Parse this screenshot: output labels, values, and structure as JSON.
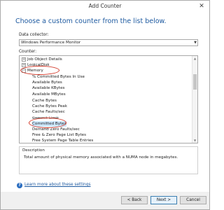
{
  "window": {
    "title": "Add Counter",
    "close_label": "✕"
  },
  "heading": "Choose a custom counter from the list below.",
  "data_collector": {
    "label": "Data collector:",
    "value": "Windows Performance Monitor",
    "arrow": "▼"
  },
  "counter": {
    "label": "Counter:",
    "rows": [
      {
        "text": "Job Object Details",
        "expander": "+"
      },
      {
        "text": "LogicalDisk",
        "expander": "+"
      },
      {
        "text": "Memory",
        "expander": "−"
      },
      {
        "text": "% Committed Bytes In Use"
      },
      {
        "text": "Available Bytes"
      },
      {
        "text": "Available KBytes"
      },
      {
        "text": "Available MBytes"
      },
      {
        "text": "Cache Bytes"
      },
      {
        "text": "Cache Bytes Peak"
      },
      {
        "text": "Cache Faults/sec"
      },
      {
        "text": "Commit Limit"
      },
      {
        "text": "Committed Bytes"
      },
      {
        "text": "Demand Zero Faults/sec"
      },
      {
        "text": "Free & Zero Page List Bytes"
      },
      {
        "text": "Free System Page Table Entries"
      }
    ],
    "scroll_up": "▲",
    "scroll_down": "▼"
  },
  "description": {
    "label": "Description",
    "text": "Total amount of physical memory associated with a NUMA node in megabytes."
  },
  "help": {
    "icon": "?",
    "link": "Learn more about these settings"
  },
  "buttons": {
    "back": "< Back",
    "next": "Next >",
    "cancel": "Cancel"
  },
  "colors": {
    "heading": "#1e5aa0",
    "annotation_circle": "#d33a2a",
    "selection": "#cde8ff"
  }
}
